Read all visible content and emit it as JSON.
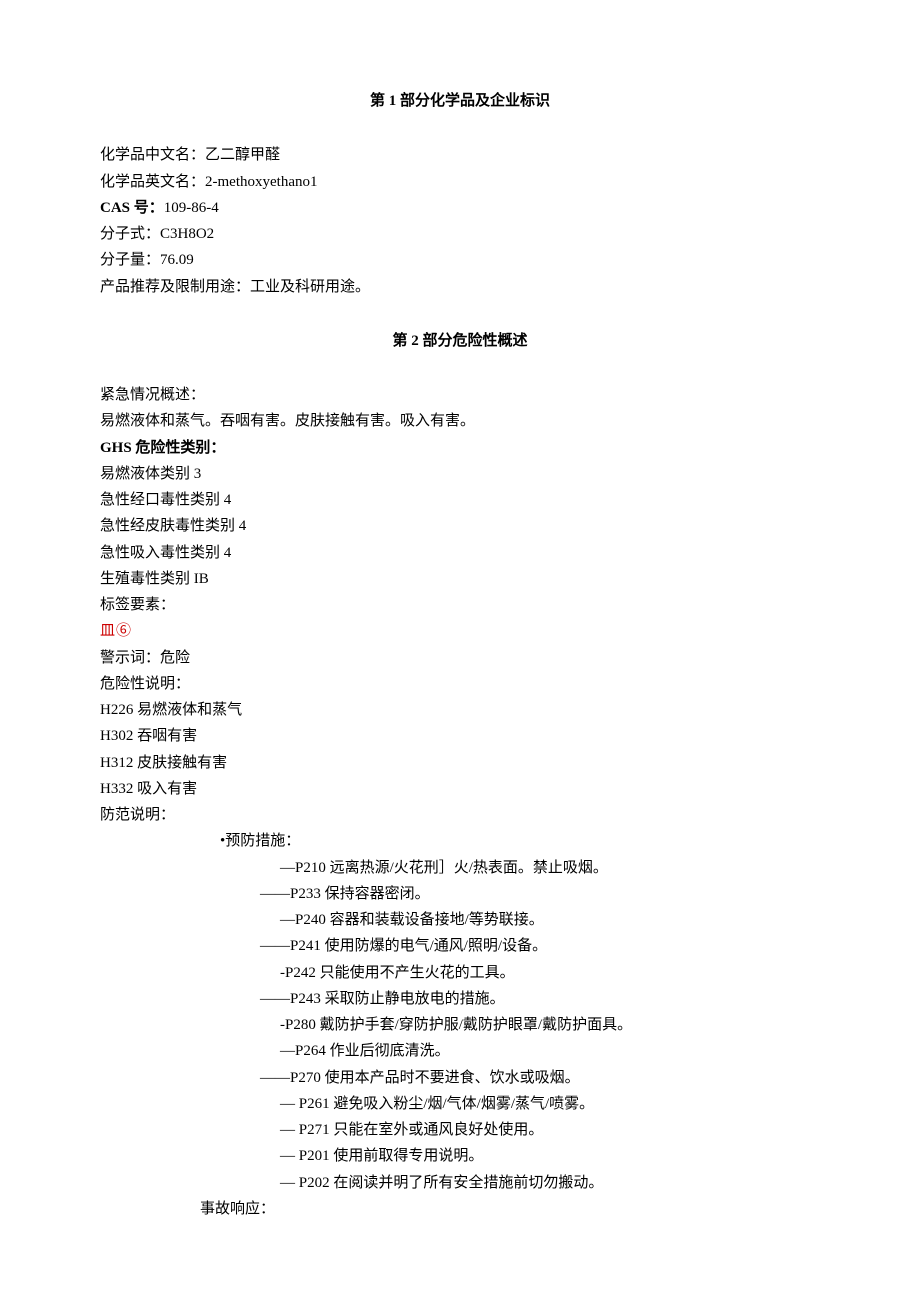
{
  "section1": {
    "title": "第 1 部分化学品及企业标识",
    "name_cn_label": "化学品中文名：",
    "name_cn": "乙二醇甲醛",
    "name_en_label": "化学品英文名：",
    "name_en": "2-methoxyethano1",
    "cas_label": "CAS 号：",
    "cas": "109-86-4",
    "formula_label": "分子式：",
    "formula": "C3H8O2",
    "mw_label": "分子量：",
    "mw": "76.09",
    "use_label": "产品推荐及限制用途：",
    "use": "工业及科研用途。"
  },
  "section2": {
    "title": "第 2 部分危险性概述",
    "emergency_label": "紧急情况概述：",
    "emergency_text": "易燃液体和蒸气。吞咽有害。皮肤接触有害。吸入有害。",
    "ghs_label": "GHS 危险性类别：",
    "ghs_items": [
      "易燃液体类别 3",
      "急性经口毒性类别 4",
      "急性经皮肤毒性类别 4",
      "急性吸入毒性类别 4",
      "生殖毒性类别 IB"
    ],
    "label_elements": "标签要素：",
    "symbols": "皿⑥",
    "signal_label": "警示词：",
    "signal": "危险",
    "hazard_statements_label": "危险性说明：",
    "hazard_statements": [
      "H226 易燃液体和蒸气",
      "H302 吞咽有害",
      "H312 皮肤接触有害",
      "H332 吸入有害"
    ],
    "precaution_label": "防范说明：",
    "prevention_label": "•预防措施：",
    "prevention_items": [
      "—P210 远离热源/火花刑］火/热表面。禁止吸烟。",
      "——P233 保持容器密闭。",
      "—P240 容器和装载设备接地/等势联接。",
      "——P241 使用防爆的电气/通风/照明/设备。",
      "-P242 只能使用不产生火花的工具。",
      "——P243 采取防止静电放电的措施。",
      "-P280 戴防护手套/穿防护服/戴防护眼罩/戴防护面具。",
      "—P264 作业后彻底清洗。",
      "——P270 使用本产品时不要进食、饮水或吸烟。",
      "—    P261 避免吸入粉尘/烟/气体/烟雾/蒸气/喷雾。",
      "—    P271 只能在室外或通风良好处使用。",
      "—    P201 使用前取得专用说明。",
      "—    P202 在阅读并明了所有安全措施前切勿搬动。"
    ],
    "response_label": "事故响应："
  }
}
